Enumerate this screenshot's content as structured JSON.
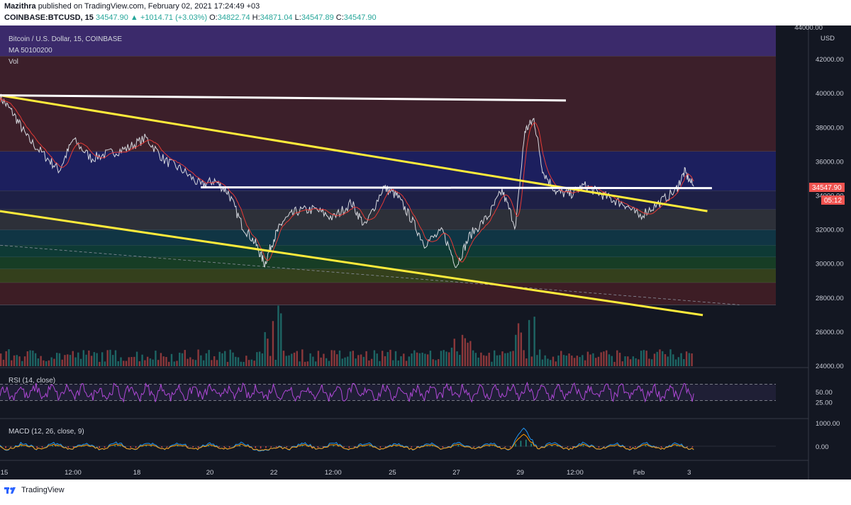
{
  "header": {
    "author": "Mazithra",
    "published": "published on TradingView.com, February 02, 2021 17:24:49 +03",
    "symbol": "COINBASE:BTCUSD, 15",
    "change": "34547.90 ▲ +1014.71 (+3.03%)",
    "ohlc_o_label": "O:",
    "ohlc_o": "34822.74",
    "ohlc_h_label": "H:",
    "ohlc_h": "34871.04",
    "ohlc_l_label": "L:",
    "ohlc_l": "34547.89",
    "ohlc_c_label": "C:",
    "ohlc_c": "34547.90"
  },
  "legend": {
    "title": "Bitcoin / U.S. Dollar, 15, COINBASE",
    "ma": "MA 50100200",
    "vol": "Vol",
    "rsi": "RSI (14, close)",
    "macd": "MACD (12, 26, close, 9)"
  },
  "price_axis": {
    "currency": "USD",
    "last_price": "34547.90",
    "countdown": "05:12",
    "top_label": "44000.00"
  },
  "footer": {
    "brand": "TradingView"
  },
  "colors": {
    "background": "#131722",
    "candle_up": "#26a69a",
    "candle_down": "#ef5350",
    "trendline": "#ffeb3b",
    "level_line": "#ffffff",
    "rsi": "#b048d8",
    "macd": "#2196f3",
    "signal": "#ff9800",
    "last_price_tag": "#ef5350"
  },
  "chart_data": {
    "type": "line",
    "title": "Bitcoin / U.S. Dollar, 15, COINBASE",
    "ylim": [
      24000,
      44000
    ],
    "y_ticks": [
      24000,
      26000,
      28000,
      30000,
      32000,
      34000,
      36000,
      38000,
      40000,
      42000
    ],
    "x_ticks": [
      "15",
      "12:00",
      "18",
      "20",
      "22",
      "12:00",
      "25",
      "27",
      "29",
      "12:00",
      "Feb",
      "3"
    ],
    "x_tick_pos": [
      0,
      1.6,
      3.0,
      4.6,
      6.0,
      7.3,
      8.6,
      10.0,
      11.4,
      12.6,
      14.0,
      15.1
    ],
    "x_range": [
      0,
      17.0
    ],
    "price": {
      "t": [
        0,
        0.3,
        0.6,
        1.0,
        1.3,
        1.6,
        2.0,
        2.4,
        2.8,
        3.2,
        3.6,
        4.0,
        4.4,
        4.7,
        5.0,
        5.3,
        5.6,
        5.8,
        6.0,
        6.2,
        6.5,
        6.9,
        7.3,
        7.7,
        8.0,
        8.4,
        8.7,
        9.0,
        9.3,
        9.7,
        10.0,
        10.3,
        10.7,
        11.0,
        11.3,
        11.5,
        11.7,
        11.9,
        12.2,
        12.5,
        12.8,
        13.1,
        13.4,
        13.7,
        14.0,
        14.4,
        14.8,
        15.0,
        15.2
      ],
      "v": [
        39800,
        38800,
        37400,
        36300,
        35500,
        37300,
        36200,
        36500,
        36800,
        37400,
        36100,
        35500,
        34600,
        34900,
        34200,
        32300,
        31200,
        30000,
        31500,
        32500,
        33100,
        33200,
        32700,
        33600,
        32200,
        34500,
        34000,
        32700,
        31200,
        31900,
        29900,
        31700,
        32800,
        34300,
        32200,
        37800,
        38500,
        35400,
        34200,
        34100,
        34600,
        34200,
        33800,
        33500,
        32800,
        33500,
        34300,
        35400,
        34548
      ]
    },
    "trendlines": [
      {
        "kind": "descending-resistance",
        "from": [
          0,
          39900
        ],
        "to": [
          15.5,
          33100
        ]
      },
      {
        "kind": "descending-support",
        "from": [
          0,
          33100
        ],
        "to": [
          15.4,
          27000
        ]
      },
      {
        "kind": "horizontal",
        "from": [
          0,
          39900
        ],
        "to": [
          12.4,
          39600
        ]
      },
      {
        "kind": "horizontal",
        "from": [
          4.4,
          34500
        ],
        "to": [
          15.6,
          34450
        ]
      }
    ],
    "zones": [
      {
        "from": 42200,
        "to": 44000,
        "color": "#3b2a6b"
      },
      {
        "from": 36600,
        "to": 42200,
        "color": "#3c1f2a"
      },
      {
        "from": 34300,
        "to": 36600,
        "color": "#1c1f5e"
      },
      {
        "from": 33200,
        "to": 34300,
        "color": "#1e2046"
      },
      {
        "from": 32000,
        "to": 33200,
        "color": "#2d3039"
      },
      {
        "from": 31100,
        "to": 32000,
        "color": "#103544"
      },
      {
        "from": 30400,
        "to": 31100,
        "color": "#0e3a35"
      },
      {
        "from": 29700,
        "to": 30400,
        "color": "#173d25"
      },
      {
        "from": 28900,
        "to": 29700,
        "color": "#34401c"
      },
      {
        "from": 27600,
        "to": 28900,
        "color": "#3d1d25"
      }
    ],
    "rsi": {
      "ylim": [
        0,
        100
      ],
      "levels": [
        70,
        30
      ],
      "ticks": [
        50,
        25
      ]
    },
    "macd": {
      "ticks": [
        "1000.00",
        "0.00"
      ]
    }
  }
}
